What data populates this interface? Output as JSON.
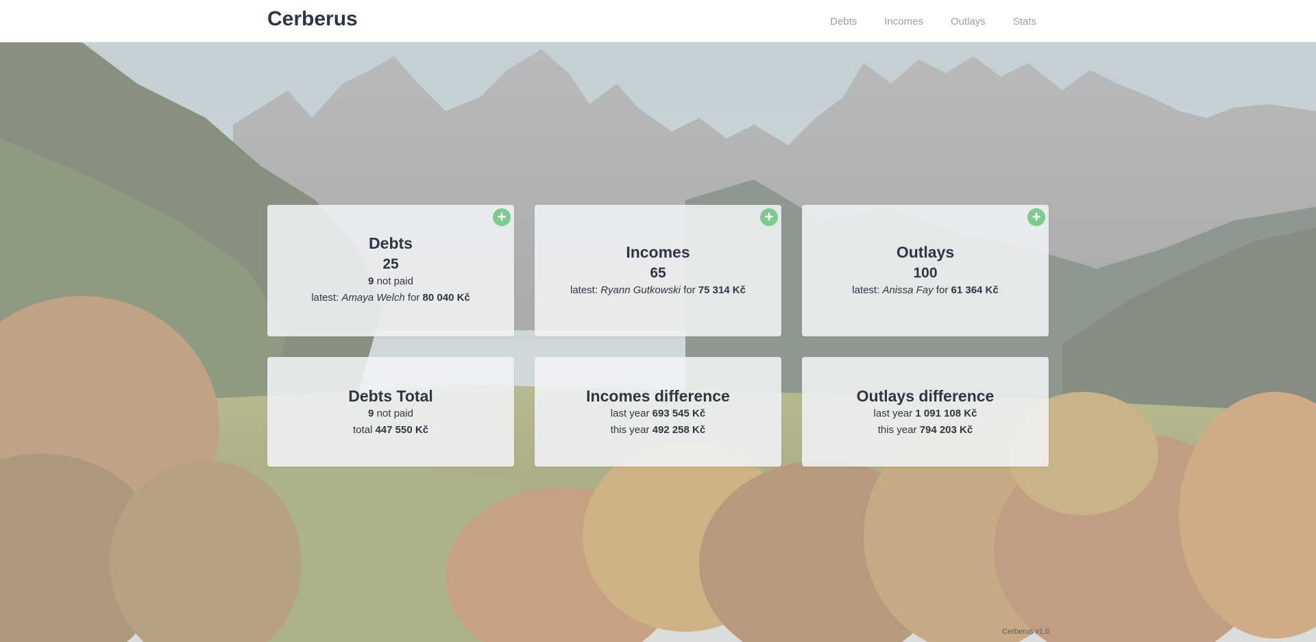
{
  "header": {
    "brand": "Cerberus",
    "nav": [
      {
        "label": "Debts"
      },
      {
        "label": "Incomes"
      },
      {
        "label": "Outlays"
      },
      {
        "label": "Stats"
      }
    ]
  },
  "cards": {
    "debts": {
      "title": "Debts",
      "count": "25",
      "not_paid_count": "9",
      "not_paid_label": "not paid",
      "latest_label": "latest:",
      "latest_name": "Amaya Welch",
      "for_label": "for",
      "latest_amount": "80 040 Kč",
      "add_icon": "plus-icon"
    },
    "incomes": {
      "title": "Incomes",
      "count": "65",
      "latest_label": "latest:",
      "latest_name": "Ryann Gutkowski",
      "for_label": "for",
      "latest_amount": "75 314 Kč",
      "add_icon": "plus-icon"
    },
    "outlays": {
      "title": "Outlays",
      "count": "100",
      "latest_label": "latest:",
      "latest_name": "Anissa Fay",
      "for_label": "for",
      "latest_amount": "61 364 Kč",
      "add_icon": "plus-icon"
    },
    "debts_total": {
      "title": "Debts Total",
      "not_paid_count": "9",
      "not_paid_label": "not paid",
      "total_label": "total",
      "total_amount": "447 550 Kč"
    },
    "incomes_difference": {
      "title": "Incomes difference",
      "last_year_label": "last year",
      "last_year_amount": "693 545 Kč",
      "this_year_label": "this year",
      "this_year_amount": "492 258 Kč"
    },
    "outlays_difference": {
      "title": "Outlays difference",
      "last_year_label": "last year",
      "last_year_amount": "1 091 108 Kč",
      "this_year_label": "this year",
      "this_year_amount": "794 203 Kč"
    }
  },
  "footer": {
    "version": "Cerberus v1.0"
  },
  "colors": {
    "add_button": "#7ecb8e",
    "text": "#2f3542",
    "nav_text": "#9aa0a8"
  }
}
